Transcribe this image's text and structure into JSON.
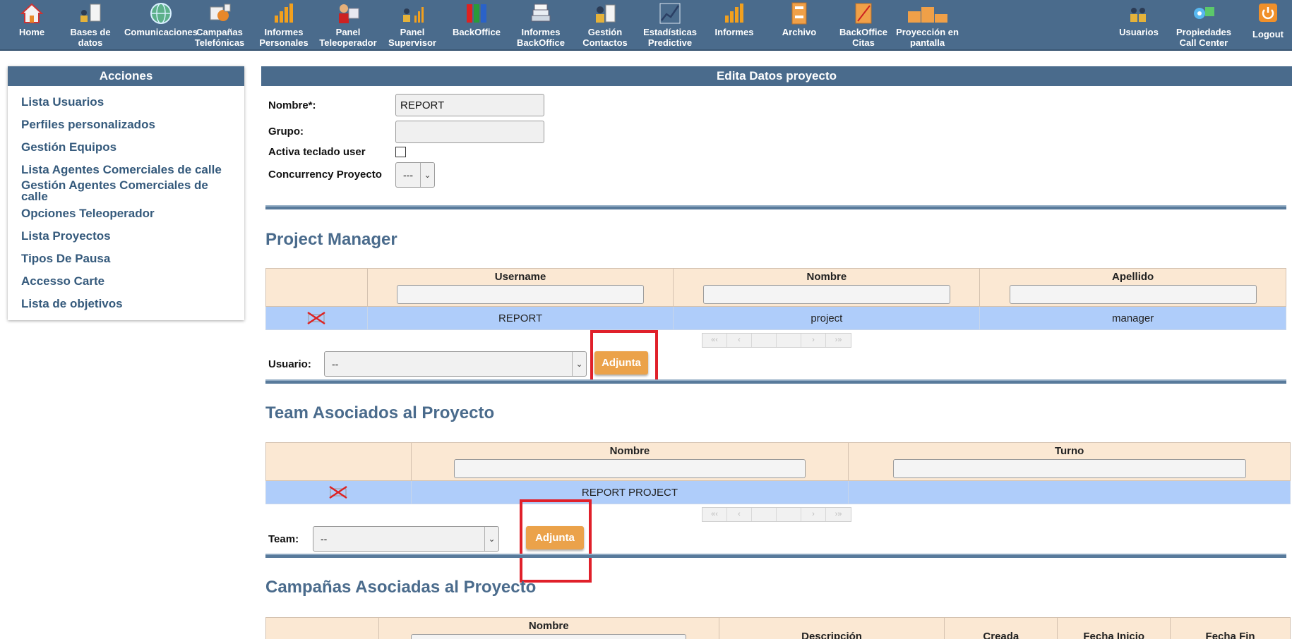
{
  "nav": {
    "left": [
      {
        "label": "Home",
        "icon": "home-icon"
      },
      {
        "label": "Bases de\ndatos",
        "icon": "database-icon"
      },
      {
        "label": "Comunicaciones",
        "icon": "globe-icon"
      },
      {
        "label": "Campañas\nTelefónicas",
        "icon": "campaigns-icon"
      },
      {
        "label": "Informes\nPersonales",
        "icon": "bar-chart-icon"
      },
      {
        "label": "Panel\nTeleoperador",
        "icon": "operator-icon"
      },
      {
        "label": "Panel\nSupervisor",
        "icon": "supervisor-icon"
      },
      {
        "label": "BackOffice",
        "icon": "binders-icon"
      },
      {
        "label": "Informes\nBackOffice",
        "icon": "stack-icon"
      },
      {
        "label": "Gestión\nContactos",
        "icon": "contacts-icon"
      },
      {
        "label": "Estadísticas\nPredictive",
        "icon": "line-chart-icon"
      },
      {
        "label": "Informes",
        "icon": "bar-chart-icon"
      },
      {
        "label": "Archivo",
        "icon": "cabinet-icon"
      },
      {
        "label": "BackOffice\nCitas",
        "icon": "notepad-icon"
      },
      {
        "label": "Proyección en\npantalla",
        "icon": "podium-icon"
      }
    ],
    "right": [
      {
        "label": "Usuarios",
        "icon": "users-icon"
      },
      {
        "label": "Propiedades\nCall Center",
        "icon": "settings-icon"
      },
      {
        "label": "Logout",
        "icon": "power-icon"
      }
    ]
  },
  "sidebar": {
    "title": "Acciones",
    "items": [
      "Lista Usuarios",
      "Perfiles personalizados",
      "Gestión Equipos",
      "Lista Agentes Comerciales de calle",
      "Gestión Agentes Comerciales de calle",
      "Opciones Teleoperador",
      "Lista Proyectos",
      "Tipos De Pausa",
      "Accesso Carte",
      "Lista de objetivos"
    ]
  },
  "main": {
    "title": "Edita Datos proyecto",
    "form": {
      "nombre_label": "Nombre*:",
      "nombre_value": "REPORT",
      "grupo_label": "Grupo:",
      "grupo_value": "",
      "teclado_label": "Activa teclado user",
      "concurrency_label": "Concurrency Proyecto",
      "concurrency_value": "---"
    },
    "pm": {
      "title": "Project Manager",
      "columns": [
        "Username",
        "Nombre",
        "Apellido"
      ],
      "rows": [
        [
          "REPORT",
          "project",
          "manager"
        ]
      ],
      "usuario_label": "Usuario:",
      "usuario_value": "--",
      "button": "Adjunta"
    },
    "team": {
      "title": "Team Asociados al Proyecto",
      "columns": [
        "Nombre",
        "Turno"
      ],
      "rows": [
        [
          "REPORT PROJECT",
          ""
        ]
      ],
      "team_label": "Team:",
      "team_value": "--",
      "button": "Adjunta"
    },
    "campaigns": {
      "title": "Campañas Asociadas al Proyecto",
      "columns": [
        "Nombre",
        "Descripción",
        "Creada",
        "Fecha Inicio",
        "Fecha Fin"
      ]
    },
    "pager": [
      "«‹",
      "‹",
      "",
      "",
      "›",
      "›»"
    ]
  },
  "colors": {
    "nav_bg": "#4a6b8c",
    "header_cell": "#fbe8d3",
    "row_bg": "#afcdfa",
    "button": "#eba24a",
    "highlight": "#e0202a"
  }
}
